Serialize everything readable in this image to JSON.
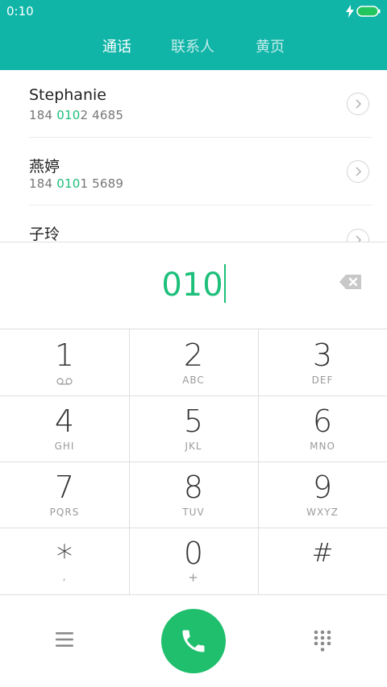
{
  "status": {
    "time": "0:10"
  },
  "tabs": [
    {
      "label": "通话",
      "active": true
    },
    {
      "label": "联系人",
      "active": false
    },
    {
      "label": "黄页",
      "active": false
    }
  ],
  "contacts": [
    {
      "name": "Stephanie",
      "num_pre": "184 ",
      "num_hl": "010",
      "num_post": "2 4685"
    },
    {
      "name": "燕婷",
      "num_pre": "184 ",
      "num_hl": "010",
      "num_post": "1 5689"
    },
    {
      "name": "子玲",
      "num_pre": "",
      "num_hl": "",
      "num_post": ""
    }
  ],
  "dial_input": {
    "value": "010"
  },
  "keys": [
    {
      "digit": "1",
      "letters": ""
    },
    {
      "digit": "2",
      "letters": "ABC"
    },
    {
      "digit": "3",
      "letters": "DEF"
    },
    {
      "digit": "4",
      "letters": "GHI"
    },
    {
      "digit": "5",
      "letters": "JKL"
    },
    {
      "digit": "6",
      "letters": "MNO"
    },
    {
      "digit": "7",
      "letters": "PQRS"
    },
    {
      "digit": "8",
      "letters": "TUV"
    },
    {
      "digit": "9",
      "letters": "WXYZ"
    },
    {
      "digit": "*",
      "letters": ","
    },
    {
      "digit": "0",
      "letters": "+"
    },
    {
      "digit": "#",
      "letters": ""
    }
  ],
  "colors": {
    "header": "#10b5a8",
    "highlight": "#1dbf7a",
    "call": "#1fbf6d"
  },
  "icons": {
    "voicemail": "voicemail-icon",
    "backspace": "backspace-icon",
    "menu": "menu-icon",
    "call": "phone-icon",
    "dialpad": "dialpad-icon"
  }
}
